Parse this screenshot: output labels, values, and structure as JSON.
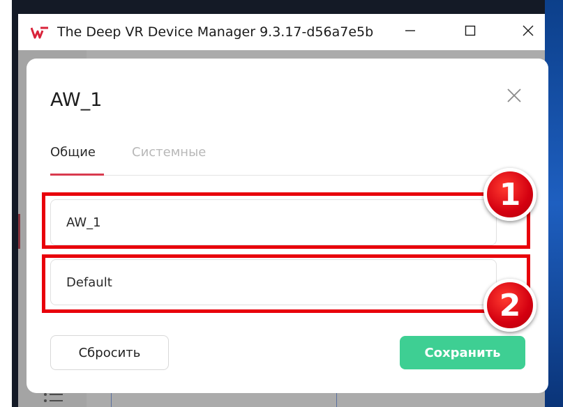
{
  "window": {
    "title": "The Deep VR Device Manager 9.3.17-d56a7e5b"
  },
  "modal": {
    "title": "AW_1",
    "tabs": [
      {
        "label": "Общие",
        "active": true
      },
      {
        "label": "Системные",
        "active": false
      }
    ],
    "fields": {
      "name_value": "AW_1",
      "group_value": "Default"
    },
    "buttons": {
      "reset_label": "Сбросить",
      "save_label": "Сохранить"
    }
  },
  "annotations": {
    "badge_1": "1",
    "badge_2": "2"
  },
  "colors": {
    "accent_red": "#d93a4e",
    "save_green": "#3ecf93",
    "annotation_red": "#e8000b"
  },
  "icons": [
    "deep-vr-logo-icon",
    "minimize-icon",
    "maximize-icon",
    "close-icon",
    "modal-close-icon",
    "list-icon"
  ]
}
